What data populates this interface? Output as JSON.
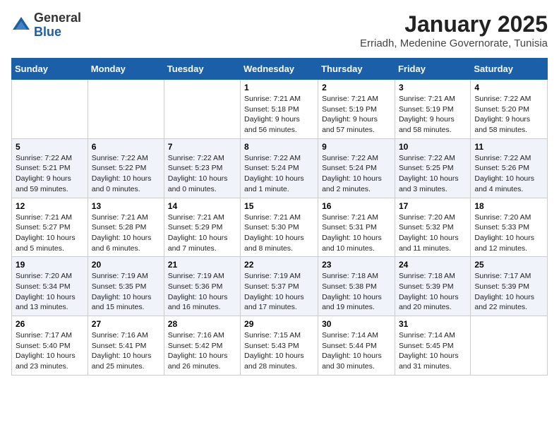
{
  "logo": {
    "general": "General",
    "blue": "Blue"
  },
  "title": "January 2025",
  "location": "Erriadh, Medenine Governorate, Tunisia",
  "weekdays": [
    "Sunday",
    "Monday",
    "Tuesday",
    "Wednesday",
    "Thursday",
    "Friday",
    "Saturday"
  ],
  "weeks": [
    [
      {
        "day": "",
        "sunrise": "",
        "sunset": "",
        "daylight": ""
      },
      {
        "day": "",
        "sunrise": "",
        "sunset": "",
        "daylight": ""
      },
      {
        "day": "",
        "sunrise": "",
        "sunset": "",
        "daylight": ""
      },
      {
        "day": "1",
        "sunrise": "Sunrise: 7:21 AM",
        "sunset": "Sunset: 5:18 PM",
        "daylight": "Daylight: 9 hours and 56 minutes."
      },
      {
        "day": "2",
        "sunrise": "Sunrise: 7:21 AM",
        "sunset": "Sunset: 5:19 PM",
        "daylight": "Daylight: 9 hours and 57 minutes."
      },
      {
        "day": "3",
        "sunrise": "Sunrise: 7:21 AM",
        "sunset": "Sunset: 5:19 PM",
        "daylight": "Daylight: 9 hours and 58 minutes."
      },
      {
        "day": "4",
        "sunrise": "Sunrise: 7:22 AM",
        "sunset": "Sunset: 5:20 PM",
        "daylight": "Daylight: 9 hours and 58 minutes."
      }
    ],
    [
      {
        "day": "5",
        "sunrise": "Sunrise: 7:22 AM",
        "sunset": "Sunset: 5:21 PM",
        "daylight": "Daylight: 9 hours and 59 minutes."
      },
      {
        "day": "6",
        "sunrise": "Sunrise: 7:22 AM",
        "sunset": "Sunset: 5:22 PM",
        "daylight": "Daylight: 10 hours and 0 minutes."
      },
      {
        "day": "7",
        "sunrise": "Sunrise: 7:22 AM",
        "sunset": "Sunset: 5:23 PM",
        "daylight": "Daylight: 10 hours and 0 minutes."
      },
      {
        "day": "8",
        "sunrise": "Sunrise: 7:22 AM",
        "sunset": "Sunset: 5:24 PM",
        "daylight": "Daylight: 10 hours and 1 minute."
      },
      {
        "day": "9",
        "sunrise": "Sunrise: 7:22 AM",
        "sunset": "Sunset: 5:24 PM",
        "daylight": "Daylight: 10 hours and 2 minutes."
      },
      {
        "day": "10",
        "sunrise": "Sunrise: 7:22 AM",
        "sunset": "Sunset: 5:25 PM",
        "daylight": "Daylight: 10 hours and 3 minutes."
      },
      {
        "day": "11",
        "sunrise": "Sunrise: 7:22 AM",
        "sunset": "Sunset: 5:26 PM",
        "daylight": "Daylight: 10 hours and 4 minutes."
      }
    ],
    [
      {
        "day": "12",
        "sunrise": "Sunrise: 7:21 AM",
        "sunset": "Sunset: 5:27 PM",
        "daylight": "Daylight: 10 hours and 5 minutes."
      },
      {
        "day": "13",
        "sunrise": "Sunrise: 7:21 AM",
        "sunset": "Sunset: 5:28 PM",
        "daylight": "Daylight: 10 hours and 6 minutes."
      },
      {
        "day": "14",
        "sunrise": "Sunrise: 7:21 AM",
        "sunset": "Sunset: 5:29 PM",
        "daylight": "Daylight: 10 hours and 7 minutes."
      },
      {
        "day": "15",
        "sunrise": "Sunrise: 7:21 AM",
        "sunset": "Sunset: 5:30 PM",
        "daylight": "Daylight: 10 hours and 8 minutes."
      },
      {
        "day": "16",
        "sunrise": "Sunrise: 7:21 AM",
        "sunset": "Sunset: 5:31 PM",
        "daylight": "Daylight: 10 hours and 10 minutes."
      },
      {
        "day": "17",
        "sunrise": "Sunrise: 7:20 AM",
        "sunset": "Sunset: 5:32 PM",
        "daylight": "Daylight: 10 hours and 11 minutes."
      },
      {
        "day": "18",
        "sunrise": "Sunrise: 7:20 AM",
        "sunset": "Sunset: 5:33 PM",
        "daylight": "Daylight: 10 hours and 12 minutes."
      }
    ],
    [
      {
        "day": "19",
        "sunrise": "Sunrise: 7:20 AM",
        "sunset": "Sunset: 5:34 PM",
        "daylight": "Daylight: 10 hours and 13 minutes."
      },
      {
        "day": "20",
        "sunrise": "Sunrise: 7:19 AM",
        "sunset": "Sunset: 5:35 PM",
        "daylight": "Daylight: 10 hours and 15 minutes."
      },
      {
        "day": "21",
        "sunrise": "Sunrise: 7:19 AM",
        "sunset": "Sunset: 5:36 PM",
        "daylight": "Daylight: 10 hours and 16 minutes."
      },
      {
        "day": "22",
        "sunrise": "Sunrise: 7:19 AM",
        "sunset": "Sunset: 5:37 PM",
        "daylight": "Daylight: 10 hours and 17 minutes."
      },
      {
        "day": "23",
        "sunrise": "Sunrise: 7:18 AM",
        "sunset": "Sunset: 5:38 PM",
        "daylight": "Daylight: 10 hours and 19 minutes."
      },
      {
        "day": "24",
        "sunrise": "Sunrise: 7:18 AM",
        "sunset": "Sunset: 5:39 PM",
        "daylight": "Daylight: 10 hours and 20 minutes."
      },
      {
        "day": "25",
        "sunrise": "Sunrise: 7:17 AM",
        "sunset": "Sunset: 5:39 PM",
        "daylight": "Daylight: 10 hours and 22 minutes."
      }
    ],
    [
      {
        "day": "26",
        "sunrise": "Sunrise: 7:17 AM",
        "sunset": "Sunset: 5:40 PM",
        "daylight": "Daylight: 10 hours and 23 minutes."
      },
      {
        "day": "27",
        "sunrise": "Sunrise: 7:16 AM",
        "sunset": "Sunset: 5:41 PM",
        "daylight": "Daylight: 10 hours and 25 minutes."
      },
      {
        "day": "28",
        "sunrise": "Sunrise: 7:16 AM",
        "sunset": "Sunset: 5:42 PM",
        "daylight": "Daylight: 10 hours and 26 minutes."
      },
      {
        "day": "29",
        "sunrise": "Sunrise: 7:15 AM",
        "sunset": "Sunset: 5:43 PM",
        "daylight": "Daylight: 10 hours and 28 minutes."
      },
      {
        "day": "30",
        "sunrise": "Sunrise: 7:14 AM",
        "sunset": "Sunset: 5:44 PM",
        "daylight": "Daylight: 10 hours and 30 minutes."
      },
      {
        "day": "31",
        "sunrise": "Sunrise: 7:14 AM",
        "sunset": "Sunset: 5:45 PM",
        "daylight": "Daylight: 10 hours and 31 minutes."
      },
      {
        "day": "",
        "sunrise": "",
        "sunset": "",
        "daylight": ""
      }
    ]
  ]
}
